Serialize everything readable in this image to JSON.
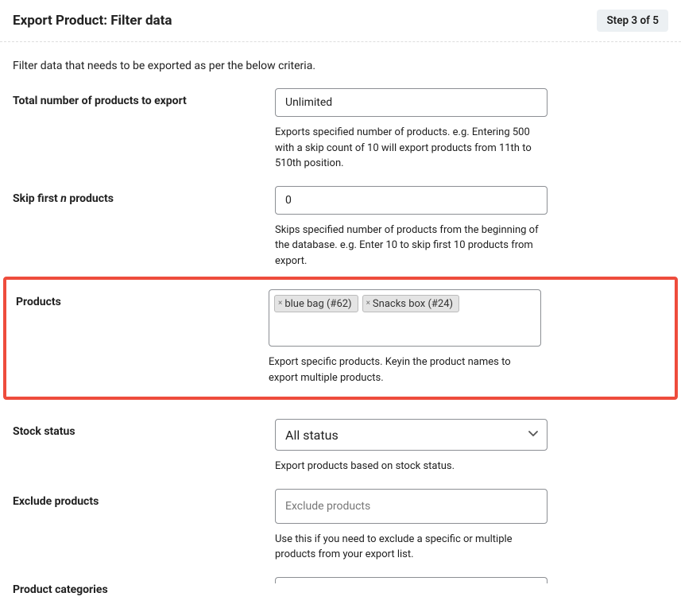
{
  "header": {
    "title": "Export Product: Filter data",
    "step_badge": "Step 3 of 5"
  },
  "intro": "Filter data that needs to be exported as per the below criteria.",
  "fields": {
    "total": {
      "label_prefix": "Total number of products to export",
      "value": "Unlimited",
      "helper": "Exports specified number of products. e.g. Entering 500 with a skip count of 10 will export products from 11th to 510th position."
    },
    "skip": {
      "label_prefix": "Skip first ",
      "label_em": "n",
      "label_suffix": " products",
      "value": "0",
      "helper": "Skips specified number of products from the beginning of the database. e.g. Enter 10 to skip first 10 products from export."
    },
    "products": {
      "label": "Products",
      "tags": [
        {
          "label": "blue bag (#62)"
        },
        {
          "label": "Snacks box (#24)"
        }
      ],
      "helper": "Export specific products. Keyin the product names to export multiple products."
    },
    "stock": {
      "label": "Stock status",
      "value": "All status",
      "helper": "Export products based on stock status."
    },
    "exclude": {
      "label": "Exclude products",
      "placeholder": "Exclude products",
      "helper": "Use this if you need to exclude a specific or multiple products from your export list."
    },
    "categories": {
      "label": "Product categories"
    }
  }
}
